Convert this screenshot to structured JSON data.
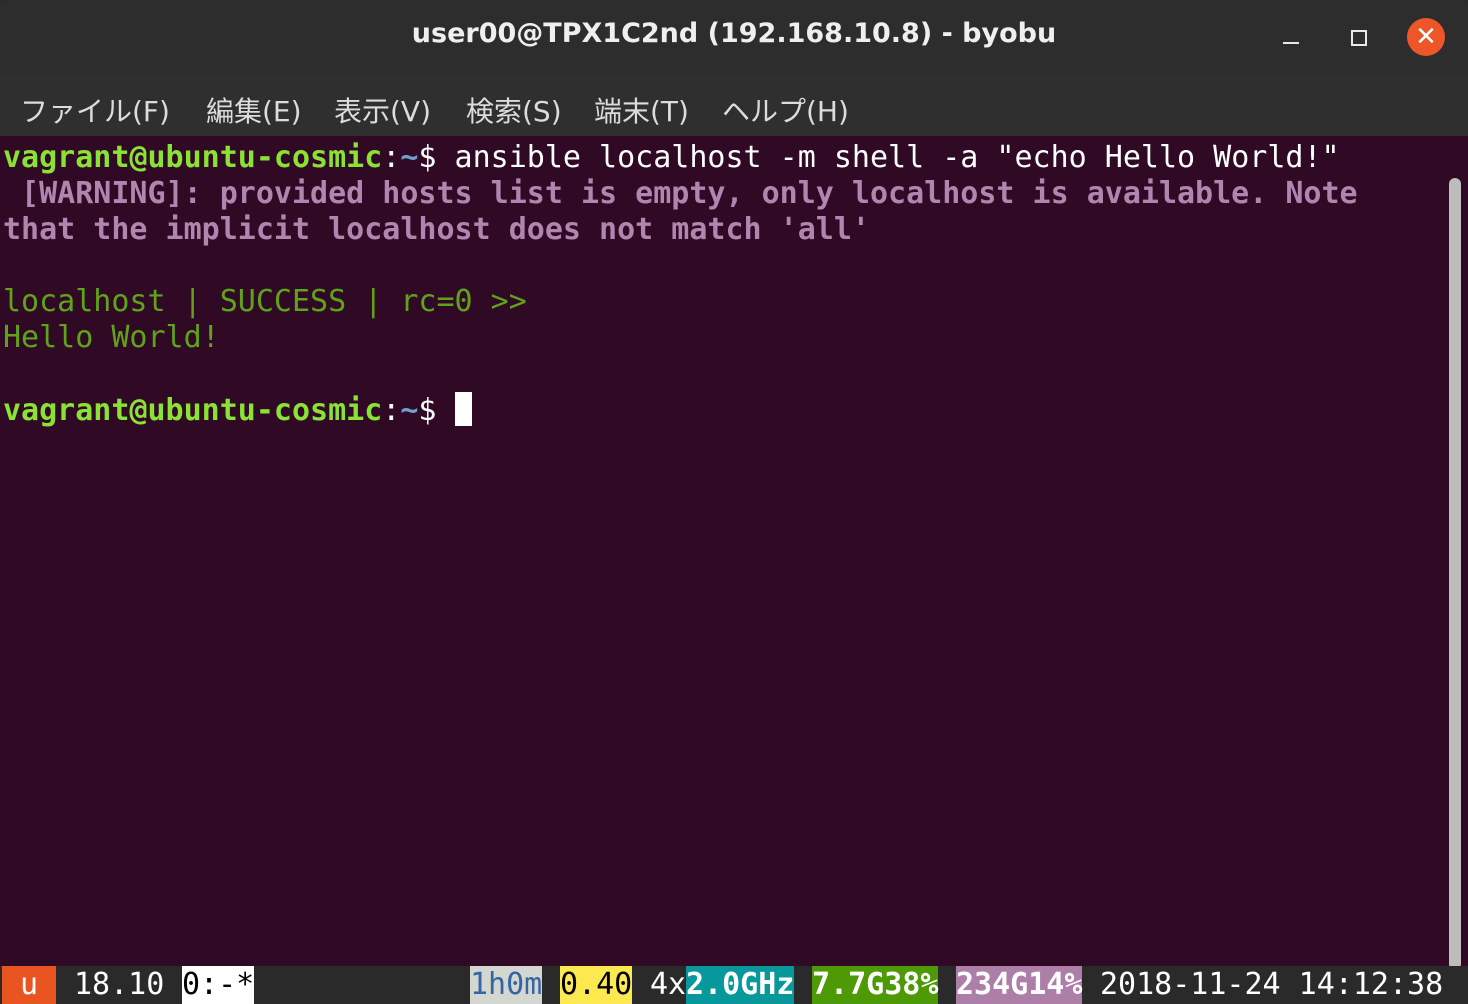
{
  "window": {
    "title": "user00@TPX1C2nd (192.168.10.8) - byobu",
    "close_glyph": "✕"
  },
  "menu": [
    "ファイル(F)",
    "編集(E)",
    "表示(V)",
    "検索(S)",
    "端末(T)",
    "ヘルプ(H)"
  ],
  "terminal": {
    "prompt_user": "vagrant@ubuntu-cosmic",
    "prompt_colon": ":",
    "prompt_path": "~",
    "prompt_symbol": "$ ",
    "command": "ansible localhost -m shell -a \"echo Hello World!\"",
    "warning_line1": " [WARNING]: provided hosts list is empty, only localhost is available. Note",
    "warning_line2": "that the implicit localhost does not match 'all'",
    "result_line": "localhost | SUCCESS | rc=0 >>",
    "output_line": "Hello World!"
  },
  "statusbar": {
    "logo": "u",
    "release": "18.10",
    "window_list": "0:-*",
    "uptime": "1h0m",
    "load": "0.40",
    "cpu_count": "4x",
    "cpu_freq": "2.0GHz",
    "memory": "7.7G38%",
    "disk": "234G14%",
    "datetime": "2018-11-24 14:12:38"
  },
  "colors": {
    "terminal_bg": "#300a24",
    "prompt_user": "#8ae234",
    "prompt_path": "#729fcf",
    "warning": "#b085b0",
    "success": "#5fa31a",
    "close_button": "#ec5629"
  }
}
